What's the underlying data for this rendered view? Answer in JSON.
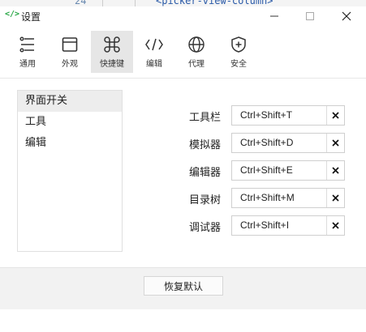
{
  "background_editor": {
    "line_number": "24",
    "code": "<picker-view-column>"
  },
  "window": {
    "logo": "</>",
    "title": "设置",
    "controls": {
      "minimize_icon": "minimize-icon",
      "maximize_icon": "maximize-icon",
      "close_icon": "close-icon"
    }
  },
  "toolbar": {
    "items": [
      {
        "label": "通用",
        "icon": "sliders-icon"
      },
      {
        "label": "外观",
        "icon": "window-icon"
      },
      {
        "label": "快捷键",
        "icon": "command-key-icon",
        "active": true
      },
      {
        "label": "编辑",
        "icon": "code-brackets-icon"
      },
      {
        "label": "代理",
        "icon": "globe-icon"
      },
      {
        "label": "安全",
        "icon": "shield-plus-icon"
      }
    ]
  },
  "sidebar": {
    "items": [
      {
        "label": "界面开关",
        "selected": true
      },
      {
        "label": "工具"
      },
      {
        "label": "编辑"
      }
    ]
  },
  "shortcuts": [
    {
      "label": "工具栏",
      "value": "Ctrl+Shift+T"
    },
    {
      "label": "模拟器",
      "value": "Ctrl+Shift+D"
    },
    {
      "label": "编辑器",
      "value": "Ctrl+Shift+E"
    },
    {
      "label": "目录树",
      "value": "Ctrl+Shift+M"
    },
    {
      "label": "调试器",
      "value": "Ctrl+Shift+I"
    }
  ],
  "footer": {
    "reset_label": "恢复默认"
  },
  "colors": {
    "accent_logo": "#27a745",
    "active_tab_bg": "#e6e6e6",
    "footer_bg": "#f2f2f2"
  }
}
